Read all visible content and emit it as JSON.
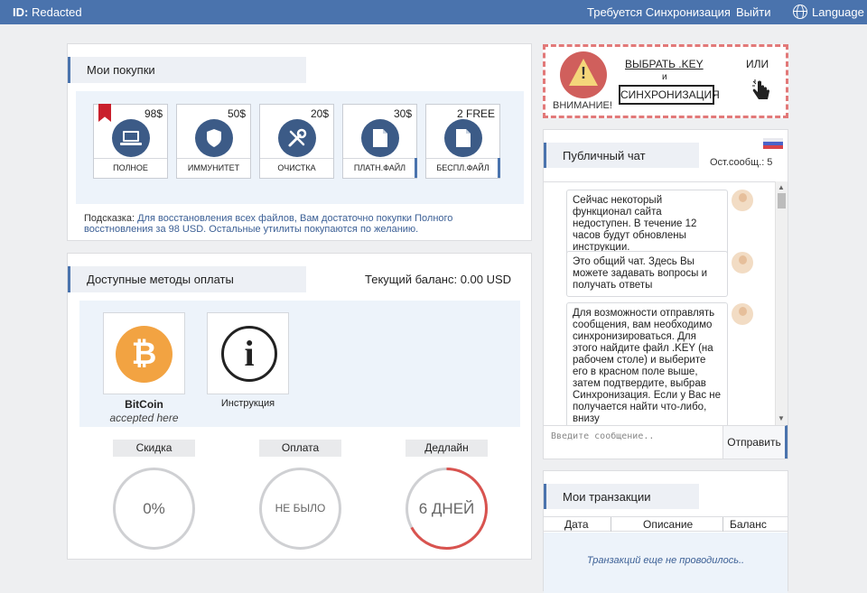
{
  "topbar": {
    "id_label": "ID:",
    "id_value": "Redacted",
    "sync": "Требуется Синхронизация",
    "logout": "Выйти",
    "language": "Language"
  },
  "purchases": {
    "title": "Мои покупки",
    "items": [
      {
        "price": "98$",
        "label": "ПОЛНОЕ",
        "icon": "laptop-icon"
      },
      {
        "price": "50$",
        "label": "ИММУНИТЕТ",
        "icon": "shield-icon"
      },
      {
        "price": "20$",
        "label": "ОЧИСТКА",
        "icon": "tools-icon"
      },
      {
        "price": "30$",
        "label": "ПЛАТН.ФАЙЛ",
        "icon": "file-icon"
      },
      {
        "price": "2 FREE",
        "label": "БЕСПЛ.ФАЙЛ",
        "icon": "file-icon"
      }
    ],
    "hint_label": "Подсказка:",
    "hint_text": "Для восстановления всех файлов, Вам достаточно покупки Полного",
    "hint_text2": "восстновления за 98 USD.",
    "hint_text3": "Остальные утилиты покупаются по желанию."
  },
  "payment": {
    "title": "Доступные методы оплаты",
    "balance": "Текущий баланс: 0.00 USD",
    "bitcoin_name": "BitCoin",
    "bitcoin_sub": "accepted here",
    "instruction": "Инструкция",
    "discount_label": "Скидка",
    "discount_value": "0%",
    "paid_label": "Оплата",
    "paid_value": "НЕ БЫЛО",
    "deadline_label": "Дедлайн",
    "deadline_value": "6 ДНЕЙ",
    "deadline_fraction": 0.67
  },
  "warning": {
    "attention": "ВНИМАНИЕ!",
    "choose_key": "ВЫБРАТЬ .KEY",
    "and": "и",
    "sync_button": "СИНХРОНИЗАЦИЯ",
    "or": "ИЛИ"
  },
  "chat": {
    "title": "Публичный чат",
    "count": "Ост.сообщ.: 5",
    "messages": [
      "Сейчас некоторый функционал сайта недоступен. В течение 12 часов будут обновлены инструкции.",
      "Это общий чат. Здесь Вы можете задавать вопросы и получать ответы",
      "Для возможности отправлять сообщения, вам необходимо синхронизироваться. Для этого найдите файл .KEY (на рабочем столе) и выберите его в красном поле выше, затем подтвердите, выбрав Синхронизация. Если у Вас не получается найти что-либо, внизу"
    ],
    "input_placeholder": "Введите сообщение..",
    "send": "Отправить"
  },
  "transactions": {
    "title": "Мои транзакции",
    "col_date": "Дата",
    "col_desc": "Описание",
    "col_balance": "Баланс",
    "empty": "Транзакций еще не проводилось.."
  },
  "colors": {
    "topbar": "#4a73ad",
    "accent_red": "#d05f5c",
    "bitcoin": "#f2a342",
    "deadline_ring": "#d9534f"
  }
}
